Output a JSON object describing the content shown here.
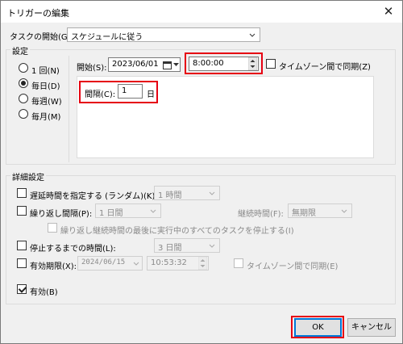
{
  "window": {
    "title": "トリガーの編集",
    "close_glyph": "✕"
  },
  "task_start": {
    "label": "タスクの開始(G):",
    "value": "スケジュールに従う"
  },
  "settings": {
    "group_label": "設定",
    "radios": [
      {
        "label": "1 回(N)",
        "selected": false
      },
      {
        "label": "毎日(D)",
        "selected": true
      },
      {
        "label": "毎週(W)",
        "selected": false
      },
      {
        "label": "毎月(M)",
        "selected": false
      }
    ],
    "start_label": "開始(S):",
    "start_date": "2023/06/01",
    "start_time": "8:00:00",
    "sync_tz_label": "タイムゾーン間で同期(Z)",
    "sync_tz_checked": false,
    "interval_label": "間隔(C):",
    "interval_value": "1",
    "interval_unit": "日"
  },
  "advanced": {
    "group_label": "詳細設定",
    "delay": {
      "label": "遅延時間を指定する (ランダム)(K):",
      "value": "1 時間",
      "checked": false
    },
    "repeat": {
      "label": "繰り返し間隔(P):",
      "value": "1 日間",
      "checked": false,
      "duration_label": "継続時間(F):",
      "duration_value": "無期限"
    },
    "stop_running": {
      "label": "繰り返し継続時間の最後に実行中のすべてのタスクを停止する(I)",
      "checked": false
    },
    "stop_after": {
      "label": "停止するまでの時間(L):",
      "value": "3 日間",
      "checked": false
    },
    "expire": {
      "label": "有効期限(X):",
      "date": "2024/06/15",
      "time": "10:53:32",
      "checked": false,
      "sync_label": "タイムゾーン間で同期(E)"
    },
    "enabled": {
      "label": "有効(B)",
      "checked": true
    }
  },
  "buttons": {
    "ok": "OK",
    "cancel": "キャンセル"
  },
  "colors": {
    "highlight": "#e60012",
    "accent": "#0078d7"
  }
}
